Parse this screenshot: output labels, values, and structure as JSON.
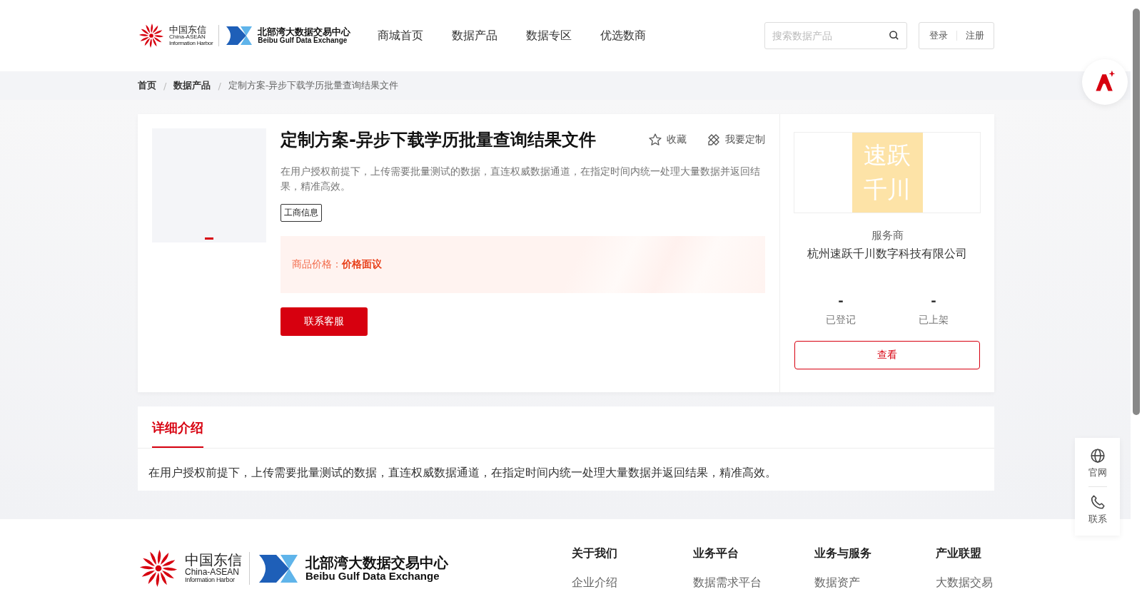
{
  "header": {
    "logo": {
      "cn": "中国东信",
      "en1": "China-ASEAN",
      "en2": "Information Harbor",
      "exchange_cn": "北部湾大数据交易中心",
      "exchange_en": "Beibu Gulf Data Exchange"
    },
    "nav": [
      {
        "label": "商城首页",
        "selected": false
      },
      {
        "label": "数据产品",
        "selected": false
      },
      {
        "label": "数据专区",
        "selected": false
      },
      {
        "label": "优选数商",
        "selected": false
      }
    ],
    "search": {
      "placeholder": "搜索数据产品"
    },
    "auth": [
      "登录",
      "注册"
    ]
  },
  "breadcrumb": {
    "separator": "/",
    "items": [
      "首页",
      "数据产品",
      "定制方案-异步下载学历批量查询结果文件"
    ]
  },
  "product": {
    "title": "定制方案-异步下载学历批量查询结果文件",
    "actions": [
      {
        "kind": "star",
        "label": "收藏"
      },
      {
        "kind": "custom",
        "label": "我要定制"
      }
    ],
    "description": "在用户授权前提下，上传需要批量测试的数据，直连权威数据通道，在指定时间内统一处理大量数据并返回结果，精准高效。",
    "tag": "工商信息",
    "price_label": "商品价格：",
    "price_value": "价格面议",
    "contact_button": "联系客服"
  },
  "provider": {
    "logo_lines": [
      "速跃",
      "千川"
    ],
    "label": "服务商",
    "name": "杭州速跃千川数字科技有限公司",
    "stats": [
      {
        "value": "-",
        "label": "已登记"
      },
      {
        "value": "-",
        "label": "已上架"
      }
    ],
    "view_button": "查看"
  },
  "details": {
    "tabs": [
      {
        "label": "详细介绍",
        "selected": true
      }
    ],
    "text": "在用户授权前提下，上传需要批量测试的数据，直连权威数据通道，在指定时间内统一处理大量数据并返回结果，精准高效。"
  },
  "side_widget": [
    {
      "kind": "globe",
      "label": "官网"
    },
    {
      "kind": "phone",
      "label": "联系"
    }
  ],
  "footer": {
    "logo": {
      "cn": "中国东信",
      "en1": "China-ASEAN",
      "en2": "Information Harbor",
      "exchange_cn": "北部湾大数据交易中心",
      "exchange_en": "Beibu Gulf Data Exchange"
    },
    "columns": [
      {
        "title": "关于我们",
        "links": [
          "企业介绍"
        ]
      },
      {
        "title": "业务平台",
        "links": [
          "数据需求平台"
        ]
      },
      {
        "title": "业务与服务",
        "links": [
          "数据资产"
        ]
      },
      {
        "title": "产业联盟",
        "links": [
          "大数据交易"
        ]
      }
    ]
  }
}
